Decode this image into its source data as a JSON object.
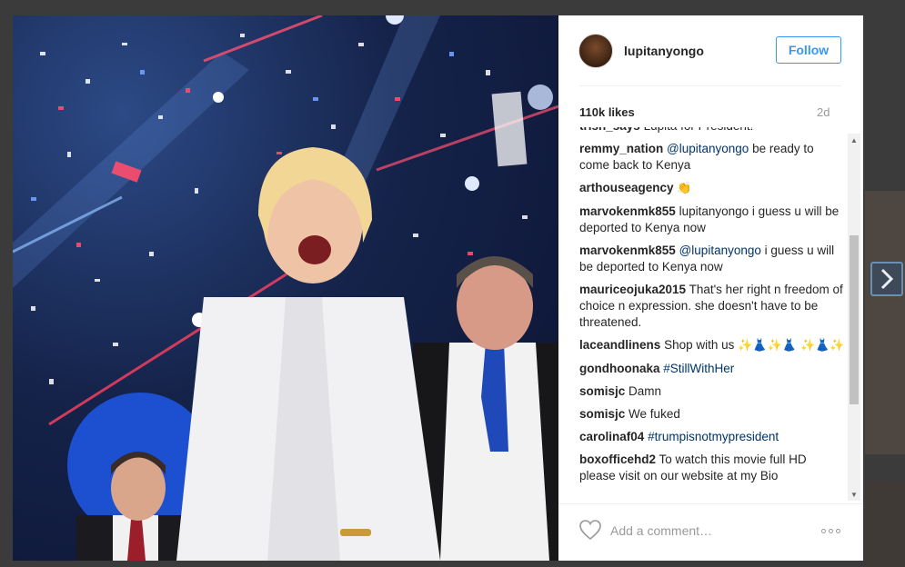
{
  "post": {
    "username": "lupitanyongo",
    "follow_label": "Follow",
    "likes": "110k likes",
    "age": "2d",
    "photo_icon": "photo"
  },
  "comments": [
    {
      "user": "trish_says",
      "parts": [
        {
          "t": "text",
          "v": "Lupita for President!"
        }
      ]
    },
    {
      "user": "remmy_nation",
      "parts": [
        {
          "t": "mention",
          "v": "@lupitanyongo"
        },
        {
          "t": "text",
          "v": " be ready to come back to Kenya"
        }
      ]
    },
    {
      "user": "arthouseagency",
      "parts": [
        {
          "t": "emoji",
          "v": "👏"
        }
      ]
    },
    {
      "user": "marvokenmk855",
      "parts": [
        {
          "t": "text",
          "v": "lupitanyongo i guess u will be deported to Kenya now"
        }
      ]
    },
    {
      "user": "marvokenmk855",
      "parts": [
        {
          "t": "mention",
          "v": "@lupitanyongo"
        },
        {
          "t": "text",
          "v": " i guess u will be deported to Kenya now"
        }
      ]
    },
    {
      "user": "mauriceojuka2015",
      "parts": [
        {
          "t": "text",
          "v": "That's her right n freedom of choice n expression. she doesn't have to be threatened."
        }
      ]
    },
    {
      "user": "laceandlinens",
      "parts": [
        {
          "t": "text",
          "v": "Shop with us "
        },
        {
          "t": "emoji",
          "v": "✨👗✨👗 ✨👗✨"
        }
      ]
    },
    {
      "user": "gondhoonaka",
      "parts": [
        {
          "t": "tag",
          "v": "#StillWithHer"
        }
      ]
    },
    {
      "user": "somisjc",
      "parts": [
        {
          "t": "text",
          "v": "Damn"
        }
      ]
    },
    {
      "user": "somisjc",
      "parts": [
        {
          "t": "text",
          "v": "We fuked"
        }
      ]
    },
    {
      "user": "carolinaf04",
      "parts": [
        {
          "t": "tag",
          "v": "#trumpisnotmypresident"
        }
      ]
    },
    {
      "user": "boxofficehd2",
      "parts": [
        {
          "t": "text",
          "v": "To watch this movie full HD please visit on our website at my Bio"
        }
      ]
    }
  ],
  "footer": {
    "comment_placeholder": "Add a comment…",
    "heart_icon": "heart-outline",
    "more_icon": "ellipsis"
  },
  "nav": {
    "next_icon": "chevron-right"
  },
  "colors": {
    "follow_blue": "#3897f0",
    "link_blue": "#003569",
    "text": "#262626",
    "muted": "#999999"
  }
}
